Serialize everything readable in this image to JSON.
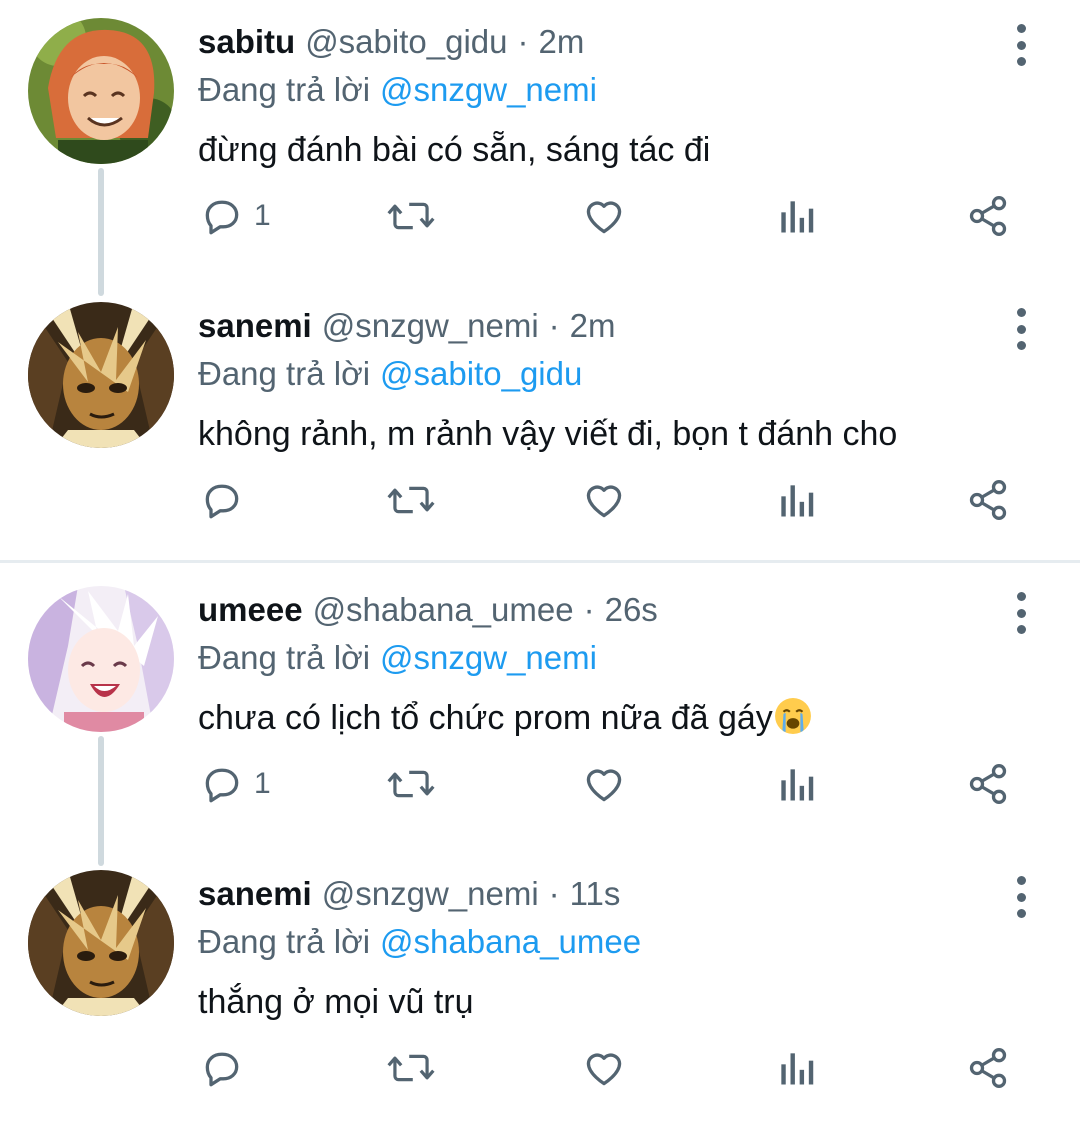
{
  "tweets": [
    {
      "display_name": "sabitu",
      "handle": "@sabito_gidu",
      "separator": "·",
      "time": "2m",
      "reply_prefix": "Đang trả lời",
      "reply_to": "@snzgw_nemi",
      "text": "đừng đánh bài có sẵn, sáng tác đi",
      "reply_count": "1",
      "avatar": "sabito-avatar",
      "avatar_colors": [
        "#6d8a35",
        "#d86d3a",
        "#f2c6a0",
        "#2f4a1c"
      ]
    },
    {
      "display_name": "sanemi",
      "handle": "@snzgw_nemi",
      "separator": "·",
      "time": "2m",
      "reply_prefix": "Đang trả lời",
      "reply_to": "@sabito_gidu",
      "text": "không rảnh, m rảnh vậy viết đi, bọn t đánh cho",
      "reply_count": "",
      "avatar": "sanemi-avatar",
      "avatar_colors": [
        "#3a2a18",
        "#e6c98a",
        "#b8843e",
        "#f1e2b6"
      ]
    },
    {
      "display_name": "umeee",
      "handle": "@shabana_umee",
      "separator": "·",
      "time": "26s",
      "reply_prefix": "Đang trả lời",
      "reply_to": "@snzgw_nemi",
      "text": "chưa có lịch tổ chức prom nữa đã gáy",
      "emoji": "crying-face-emoji",
      "reply_count": "1",
      "avatar": "umeee-avatar",
      "avatar_colors": [
        "#f3eef6",
        "#c9b3e0",
        "#e08aa3",
        "#9a7bb8"
      ]
    },
    {
      "display_name": "sanemi",
      "handle": "@snzgw_nemi",
      "separator": "·",
      "time": "11s",
      "reply_prefix": "Đang trả lời",
      "reply_to": "@shabana_umee",
      "text": "thắng ở mọi vũ trụ",
      "reply_count": "",
      "avatar": "sanemi-avatar",
      "avatar_colors": [
        "#3a2a18",
        "#e6c98a",
        "#b8843e",
        "#f1e2b6"
      ]
    }
  ],
  "icons": {
    "reply": "reply-icon",
    "retweet": "retweet-icon",
    "like": "heart-icon",
    "views": "analytics-icon",
    "share": "share-icon",
    "more": "more-vertical-icon"
  },
  "colors": {
    "link": "#1d9bf0",
    "secondary_text": "#536471",
    "thread_line": "#cfd9de",
    "divider": "#e6ecf0"
  }
}
